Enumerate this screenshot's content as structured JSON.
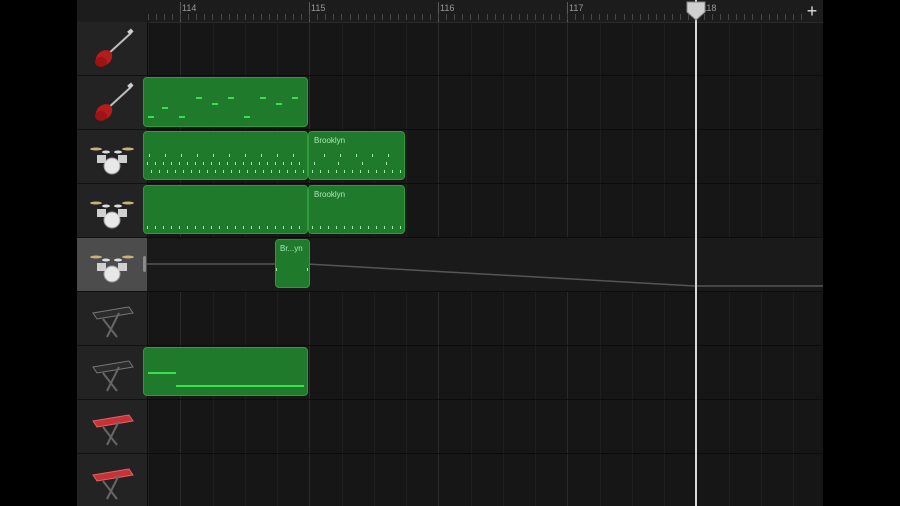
{
  "ruler": {
    "bar_labels": [
      "114",
      "115",
      "116",
      "117",
      "118"
    ],
    "add_label": "+"
  },
  "tracks": [
    {
      "instrument": "electric-guitar-icon",
      "selected": false
    },
    {
      "instrument": "electric-guitar-icon",
      "selected": false
    },
    {
      "instrument": "drum-kit-icon",
      "selected": false
    },
    {
      "instrument": "drum-kit-icon",
      "selected": false
    },
    {
      "instrument": "drum-kit-icon",
      "selected": true
    },
    {
      "instrument": "keyboard-icon",
      "selected": false
    },
    {
      "instrument": "keyboard-icon",
      "selected": false
    },
    {
      "instrument": "red-keyboard-icon",
      "selected": false
    },
    {
      "instrument": "red-keyboard-icon",
      "selected": false
    }
  ],
  "regions": {
    "drums1_brooklyn": "Brooklyn",
    "drums2_brooklyn": "Brooklyn",
    "drums3_short": "Br...yn"
  },
  "colors": {
    "region_fill": "#1f7a2c",
    "region_border": "#2e9b3d",
    "note": "#38e04e",
    "playhead": "#d8d8d8",
    "selected_track": "#4c4c4c"
  }
}
